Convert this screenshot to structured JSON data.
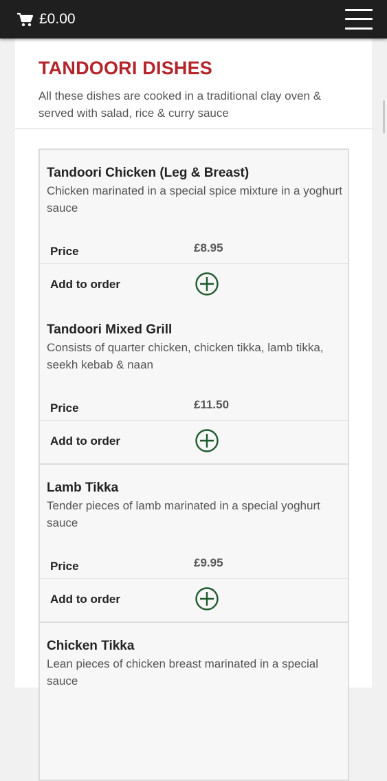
{
  "header": {
    "cart_icon": "shopping-cart-icon",
    "cart_total": "£0.00",
    "menu_icon": "hamburger-menu-icon",
    "background": "#1f1f1f"
  },
  "section": {
    "title": "TANDOORI DISHES",
    "description": "All these dishes are cooked in a traditional clay oven & served with salad, rice & curry sauce",
    "title_color": "#b3252a"
  },
  "labels": {
    "price": "Price",
    "add_to_order": "Add to order"
  },
  "dishes": [
    {
      "name": "Tandoori Chicken (Leg & Breast)",
      "description": "Chicken marinated in a special spice mixture in a yoghurt sauce",
      "price": "£8.95"
    },
    {
      "name": "Tandoori Mixed Grill",
      "description": "Consists of quarter chicken, chicken tikka, lamb tikka, seekh kebab & naan",
      "price": "£11.50"
    },
    {
      "name": "Lamb Tikka",
      "description": "Tender pieces of lamb marinated in a special yoghurt sauce",
      "price": "£9.95"
    },
    {
      "name": "Chicken Tikka",
      "description": "Lean pieces of chicken breast marinated in a special sauce",
      "price": ""
    }
  ],
  "add_icon": "plus-circle-icon",
  "add_icon_color": "#1d5a2c"
}
